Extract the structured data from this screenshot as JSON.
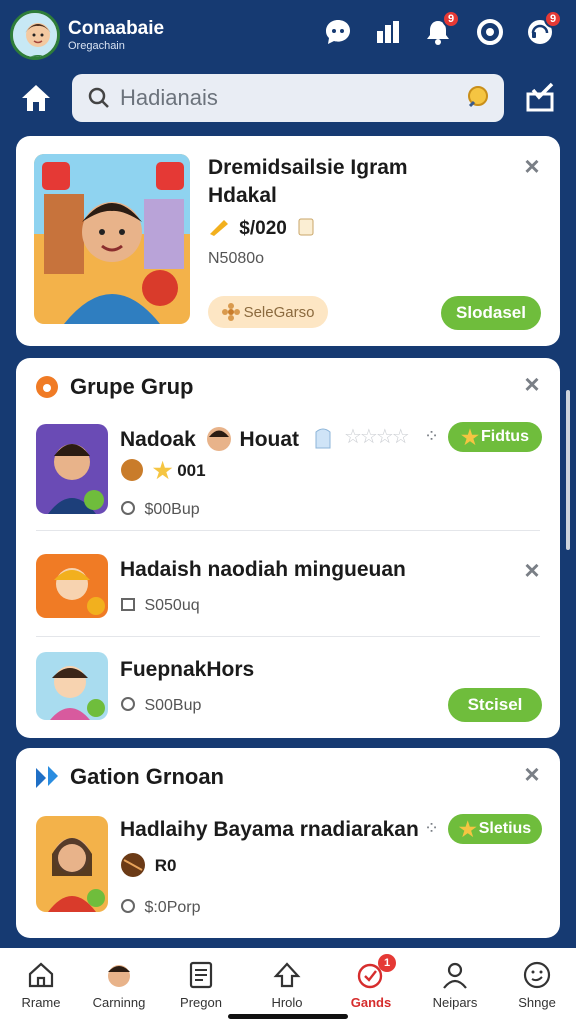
{
  "header": {
    "brand_name": "Conaabaie",
    "brand_sub": "Oregachain",
    "notif_badges": {
      "bell": "9",
      "profile": "9"
    }
  },
  "search": {
    "placeholder": "Hadianais"
  },
  "featured": {
    "title_line1": "Dremidsailsie Igram",
    "title_line2": "Hdakal",
    "price": "$/020",
    "price_meta": "N5080o",
    "tag": "SeleGarso",
    "button": "Slodasel"
  },
  "group1": {
    "title": "Grupe Grup",
    "items": [
      {
        "title": "Nadoak",
        "name2": "Houat",
        "count": "001",
        "meta": "$00Bup",
        "button": "Fidtus"
      },
      {
        "title": "Hadaish naodiah mingueuan",
        "meta": "S050uq"
      },
      {
        "title": "FuepnakHors",
        "meta": "S00Bup",
        "button": "Stcisel"
      }
    ]
  },
  "group2": {
    "title": "Gation Grnoan",
    "items": [
      {
        "title": "Hadlaihy Bayama rnadiarakan",
        "count": "R0",
        "meta": "$:0Porp",
        "button": "Sletius"
      }
    ]
  },
  "nav": [
    {
      "label": "Rrame",
      "icon": "home-outline-icon"
    },
    {
      "label": "Carninng",
      "icon": "avatar-icon"
    },
    {
      "label": "Pregon",
      "icon": "document-icon"
    },
    {
      "label": "Hrolo",
      "icon": "share-icon"
    },
    {
      "label": "Gands",
      "icon": "games-icon",
      "active": true,
      "badge": "1"
    },
    {
      "label": "Neipars",
      "icon": "person-icon"
    },
    {
      "label": "Shnge",
      "icon": "smiley-icon"
    }
  ],
  "colors": {
    "background": "#163a72",
    "accent_green": "#6fbd3c",
    "badge_red": "#e53935",
    "active_nav": "#d62d2d"
  }
}
